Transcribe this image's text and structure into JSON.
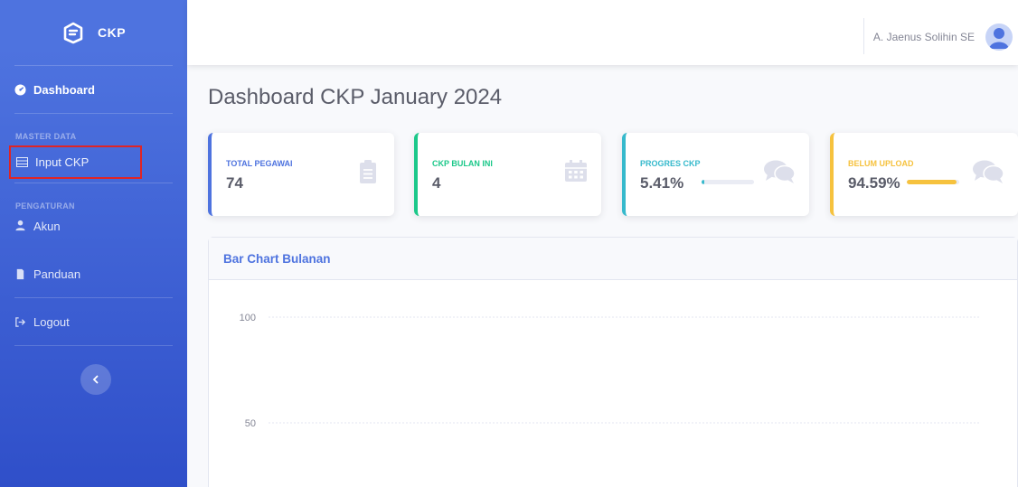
{
  "sidebar": {
    "brand": "CKP",
    "items": [
      {
        "label": "Dashboard",
        "icon": "tachometer-icon"
      },
      {
        "label": "Input CKP",
        "icon": "table-icon"
      },
      {
        "label": "Akun",
        "icon": "user-icon"
      },
      {
        "label": "Panduan",
        "icon": "file-icon"
      },
      {
        "label": "Logout",
        "icon": "sign-out-icon"
      }
    ],
    "headings": [
      "MASTER DATA",
      "PENGATURAN"
    ],
    "toggle_icon": "chevron-left-icon"
  },
  "topbar": {
    "user_name": "A. Jaenus Solihin SE",
    "avatar_icon": "user-avatar-icon"
  },
  "page": {
    "title": "Dashboard CKP January 2024"
  },
  "cards": [
    {
      "label": "TOTAL PEGAWAI",
      "value": "74",
      "color": "#4e73df",
      "icon": "clipboard-list-icon"
    },
    {
      "label": "CKP BULAN INI",
      "value": "4",
      "color": "#1cc88a",
      "icon": "calendar-icon"
    },
    {
      "label": "PROGRES CKP",
      "value": "5.41%",
      "progress": 5.41,
      "color": "#36b9cc",
      "icon": "comments-icon"
    },
    {
      "label": "BELUM UPLOAD",
      "value": "94.59%",
      "progress": 94.59,
      "color": "#f6c23e",
      "icon": "comments-icon"
    }
  ],
  "chart": {
    "title": "Bar Chart Bulanan"
  },
  "chart_data": {
    "type": "bar",
    "title": "Bar Chart Bulanan",
    "y_ticks": [
      100,
      50
    ],
    "grid": true,
    "categories": [],
    "values": []
  }
}
